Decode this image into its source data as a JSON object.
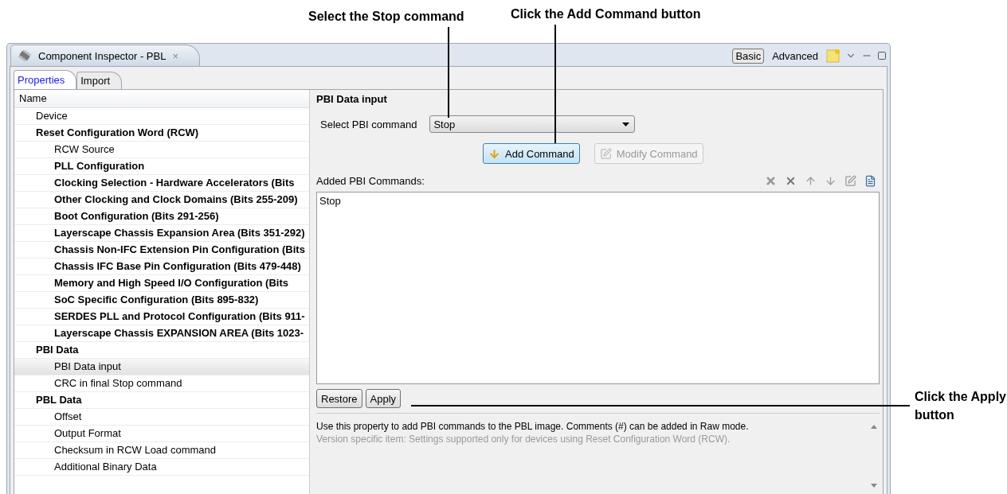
{
  "callouts": [
    {
      "text": "Select the Stop command",
      "kind": "top"
    },
    {
      "text": "Click the Add Command button",
      "kind": "top"
    },
    {
      "text": "Click the Apply button",
      "kind": "side"
    }
  ],
  "window": {
    "title": "Component Inspector - PBL",
    "close": "×"
  },
  "modes": [
    {
      "label": "Basic",
      "selected": true
    },
    {
      "label": "Advanced",
      "selected": false
    }
  ],
  "tabs": [
    {
      "label": "Properties",
      "selected": true
    },
    {
      "label": "Import",
      "selected": false
    }
  ],
  "tree": {
    "header": "Name",
    "items": [
      {
        "label": "Device",
        "kind": "property",
        "selected": false
      },
      {
        "label": "Reset Configuration Word (RCW)",
        "kind": "group",
        "selected": false,
        "children": [
          {
            "label": "RCW Source",
            "kind": "property",
            "selected": false
          },
          {
            "label": "PLL Configuration",
            "kind": "group",
            "selected": false
          },
          {
            "label": "Clocking Selection - Hardware Accelerators (Bits",
            "kind": "group",
            "selected": false
          },
          {
            "label": "Other Clocking and Clock Domains (Bits 255-209)",
            "kind": "group",
            "selected": false
          },
          {
            "label": "Boot Configuration (Bits 291-256)",
            "kind": "group",
            "selected": false
          },
          {
            "label": "Layerscape Chassis Expansion Area (Bits 351-292)",
            "kind": "group",
            "selected": false
          },
          {
            "label": "Chassis Non-IFC Extension Pin Configuration (Bits",
            "kind": "group",
            "selected": false
          },
          {
            "label": "Chassis IFC Base Pin Configuration (Bits 479-448)",
            "kind": "group",
            "selected": false
          },
          {
            "label": "Memory and High Speed I/O Configuration (Bits",
            "kind": "group",
            "selected": false
          },
          {
            "label": "SoC Specific Configuration (Bits 895-832)",
            "kind": "group",
            "selected": false
          },
          {
            "label": "SERDES PLL and Protocol Configuration (Bits 911-",
            "kind": "group",
            "selected": false
          },
          {
            "label": "Layerscape Chassis EXPANSION AREA (Bits 1023-",
            "kind": "group",
            "selected": false
          }
        ]
      },
      {
        "label": "PBI Data",
        "kind": "group",
        "selected": false,
        "children": [
          {
            "label": "PBI Data input",
            "kind": "property",
            "selected": true
          },
          {
            "label": "CRC in final Stop command",
            "kind": "property",
            "selected": false
          }
        ]
      },
      {
        "label": "PBL Data",
        "kind": "group",
        "selected": false,
        "children": [
          {
            "label": "Offset",
            "kind": "property",
            "selected": false
          },
          {
            "label": "Output Format",
            "kind": "property",
            "selected": false
          },
          {
            "label": "Checksum in RCW Load command",
            "kind": "property",
            "selected": false
          },
          {
            "label": "Additional Binary Data",
            "kind": "property",
            "selected": false
          }
        ]
      }
    ]
  },
  "panel": {
    "title": "PBI Data input",
    "select_label": "Select PBI command",
    "select_value": "Stop",
    "buttons": [
      {
        "label": "Add Command",
        "disabled": false,
        "focused": true
      },
      {
        "label": "Modify Command",
        "disabled": true,
        "focused": false
      }
    ],
    "list_label": "Added PBI Commands:",
    "commands": [
      "Stop"
    ],
    "actions": [
      {
        "label": "Restore"
      },
      {
        "label": "Apply"
      }
    ],
    "description": "Use this property to add PBI commands to the PBL image. Comments (#) can be added in Raw mode.",
    "note": "Version specific item: Settings supported only for devices using Reset Configuration Word (RCW)."
  }
}
